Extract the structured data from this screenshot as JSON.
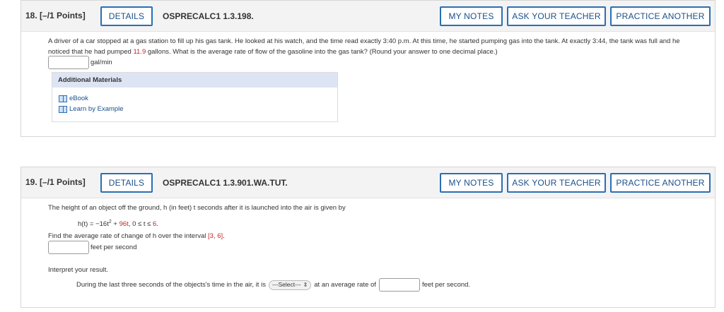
{
  "q18": {
    "number": "18.",
    "points": "[–/1 Points]",
    "details_label": "DETAILS",
    "code": "OSPRECALC1 1.3.198.",
    "my_notes_label": "MY NOTES",
    "ask_teacher_label": "ASK YOUR TEACHER",
    "practice_label": "PRACTICE ANOTHER",
    "text_part1": "A driver of a car stopped at a gas station to fill up his gas tank. He looked at his watch, and the time read exactly 3:40 p.m. At this time, he started pumping gas into the tank. At exactly 3:44, the tank was full and he noticed that he had pumped ",
    "gallons_value": "11.9",
    "text_part2": " gallons. What is the average rate of flow of the gasoline into the gas tank? (Round your answer to one decimal place.)",
    "answer_unit": "gal/min",
    "answer_value": "",
    "additional_materials_title": "Additional Materials",
    "materials": [
      "eBook",
      "Learn by Example"
    ]
  },
  "q19": {
    "number": "19.",
    "points": "[–/1 Points]",
    "details_label": "DETAILS",
    "code": "OSPRECALC1 1.3.901.WA.TUT.",
    "my_notes_label": "MY NOTES",
    "ask_teacher_label": "ASK YOUR TEACHER",
    "practice_label": "PRACTICE ANOTHER",
    "intro": "The height of an object off the ground, h (in feet) t seconds after it is launched into the air is given by",
    "formula_lhs": "h(t) = ",
    "formula_coef1": "−16t",
    "formula_exp": "2",
    "formula_plus": " + ",
    "formula_coef2": "96t",
    "formula_domain_pre": ",     0 ≤ t ≤ ",
    "formula_domain_end": "6",
    "formula_domain_post": ".",
    "find_text_pre": "Find the average rate of change of h over the interval ",
    "interval": "[3, 6]",
    "find_text_post": ".",
    "answer_unit": "feet per second",
    "interpret_label": "Interpret your result.",
    "interpret_pre": "During the last three seconds of the objects's time in the air, it is ",
    "select_value": "---Select---",
    "interpret_mid": " at an average rate of ",
    "interpret_post": " feet per second."
  }
}
